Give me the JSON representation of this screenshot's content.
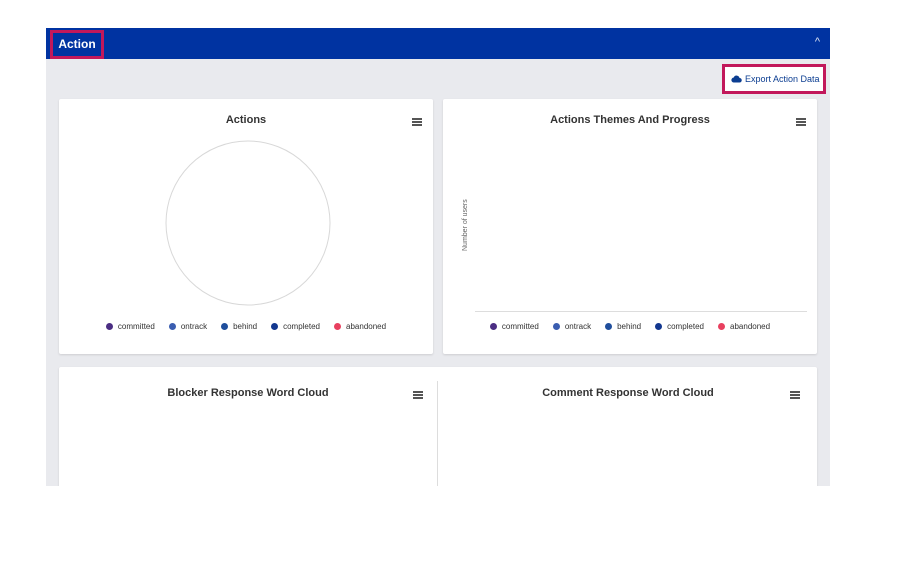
{
  "panel": {
    "title": "Action",
    "collapse_icon": "^"
  },
  "export": {
    "label": "Export Action Data",
    "icon": "cloud-icon"
  },
  "cards": {
    "actions": {
      "title": "Actions"
    },
    "themes": {
      "title": "Actions Themes And Progress",
      "y_axis_label": "Number of users"
    },
    "blocker": {
      "title": "Blocker Response Word Cloud"
    },
    "comment": {
      "title": "Comment Response Word Cloud"
    }
  },
  "legend": [
    {
      "label": "committed",
      "color": "#4b2e83"
    },
    {
      "label": "ontrack",
      "color": "#3a5db0"
    },
    {
      "label": "behind",
      "color": "#1f4e9c"
    },
    {
      "label": "completed",
      "color": "#12378f"
    },
    {
      "label": "abandoned",
      "color": "#e8405f"
    }
  ]
}
